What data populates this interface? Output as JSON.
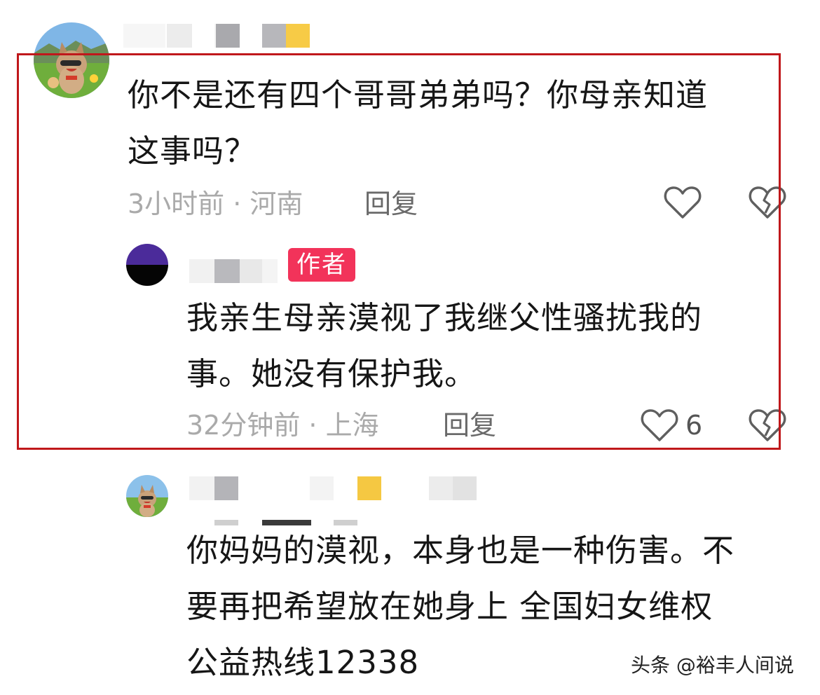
{
  "comments": [
    {
      "text_lines": [
        "你不是还有四个哥哥弟弟吗？你母亲知道",
        "这事吗？"
      ],
      "meta": "3小时前 · 河南",
      "reply_label": "回复",
      "like_icon": "heart-icon",
      "dislike_icon": "broken-heart-icon"
    },
    {
      "badge": "作者",
      "text_lines": [
        "我亲生母亲漠视了我继父性骚扰我的",
        "事。她没有保护我。"
      ],
      "meta": "32分钟前 · 上海",
      "reply_label": "回复",
      "like_count": "6",
      "like_icon": "heart-icon",
      "dislike_icon": "broken-heart-icon"
    },
    {
      "text_lines": [
        "你妈妈的漠视，本身也是一种伤害。不",
        "要再把希望放在她身上  全国妇女维权",
        "公益热线12338"
      ]
    }
  ],
  "watermark": "头条 @裕丰人间说",
  "colors": {
    "highlight_border": "#c0181b",
    "author_badge": "#f2335a",
    "text": "#161616",
    "meta": "#aaaaaa"
  }
}
